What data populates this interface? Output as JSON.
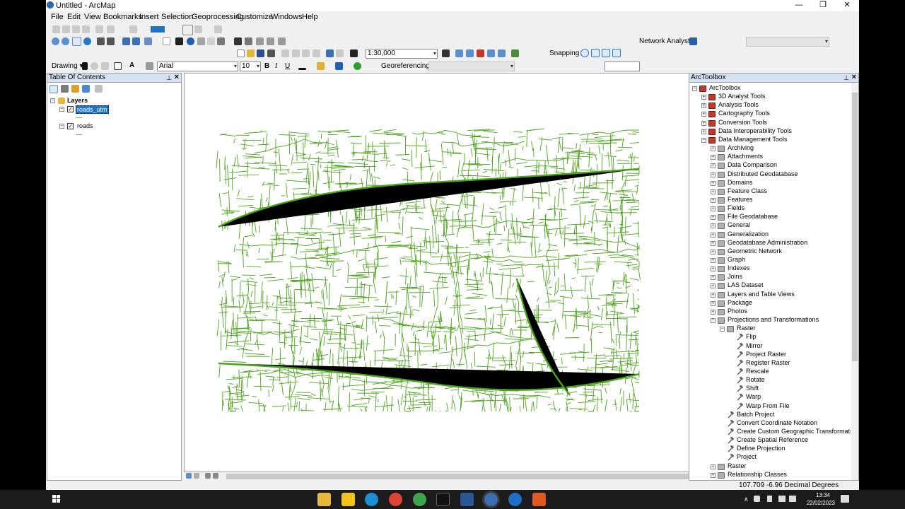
{
  "window": {
    "title": "Untitled - ArcMap",
    "minimize": "—",
    "restore": "❐",
    "close": "✕"
  },
  "menu": [
    "File",
    "Edit",
    "View",
    "Bookmarks",
    "Insert",
    "Selection",
    "Geoprocessing",
    "Customize",
    "Windows",
    "Help"
  ],
  "toolbar": {
    "network_analyst": "Network Analyst ▾",
    "scale": "1:30,000",
    "snapping": "Snapping ▾",
    "drawing": "Drawing ▾",
    "font": "Arial",
    "font_size": "10",
    "georeferencing": "Georeferencing ▾",
    "bold": "B",
    "italic": "I",
    "underline": "U",
    "text_tool": "A"
  },
  "toc": {
    "title": "Table Of Contents",
    "group": "Layers",
    "layers": [
      {
        "name": "roads_utm",
        "checked": true,
        "selected": true,
        "swatch": "#7fbf3f"
      },
      {
        "name": "roads",
        "checked": true,
        "selected": false,
        "swatch": "#e1866f"
      }
    ]
  },
  "map": {
    "road_color": "#4ca31d"
  },
  "arctoolbox": {
    "title": "ArcToolbox",
    "root": "ArcToolbox",
    "toolboxes": [
      "3D Analyst Tools",
      "Analysis Tools",
      "Cartography Tools",
      "Conversion Tools",
      "Data Interoperability Tools",
      "Data Management Tools"
    ],
    "dm_toolsets": [
      "Archiving",
      "Attachments",
      "Data Comparison",
      "Distributed Geodatabase",
      "Domains",
      "Feature Class",
      "Features",
      "Fields",
      "File Geodatabase",
      "General",
      "Generalization",
      "Geodatabase Administration",
      "Geometric Network",
      "Graph",
      "Indexes",
      "Joins",
      "LAS Dataset",
      "Layers and Table Views",
      "Package",
      "Photos",
      "Projections and Transformations"
    ],
    "raster_set": "Raster",
    "raster_tools": [
      "Flip",
      "Mirror",
      "Project Raster",
      "Register Raster",
      "Rescale",
      "Rotate",
      "Shift",
      "Warp",
      "Warp From File"
    ],
    "proj_tools": [
      "Batch Project",
      "Convert Coordinate Notation",
      "Create Custom Geographic Transformation",
      "Create Spatial Reference",
      "Define Projection",
      "Project"
    ],
    "after": [
      "Raster",
      "Relationship Classes"
    ]
  },
  "status": {
    "coords": "107.709  -6.96 Decimal Degrees"
  },
  "taskbar": {
    "time": "13:34",
    "date": "22/02/2023"
  }
}
